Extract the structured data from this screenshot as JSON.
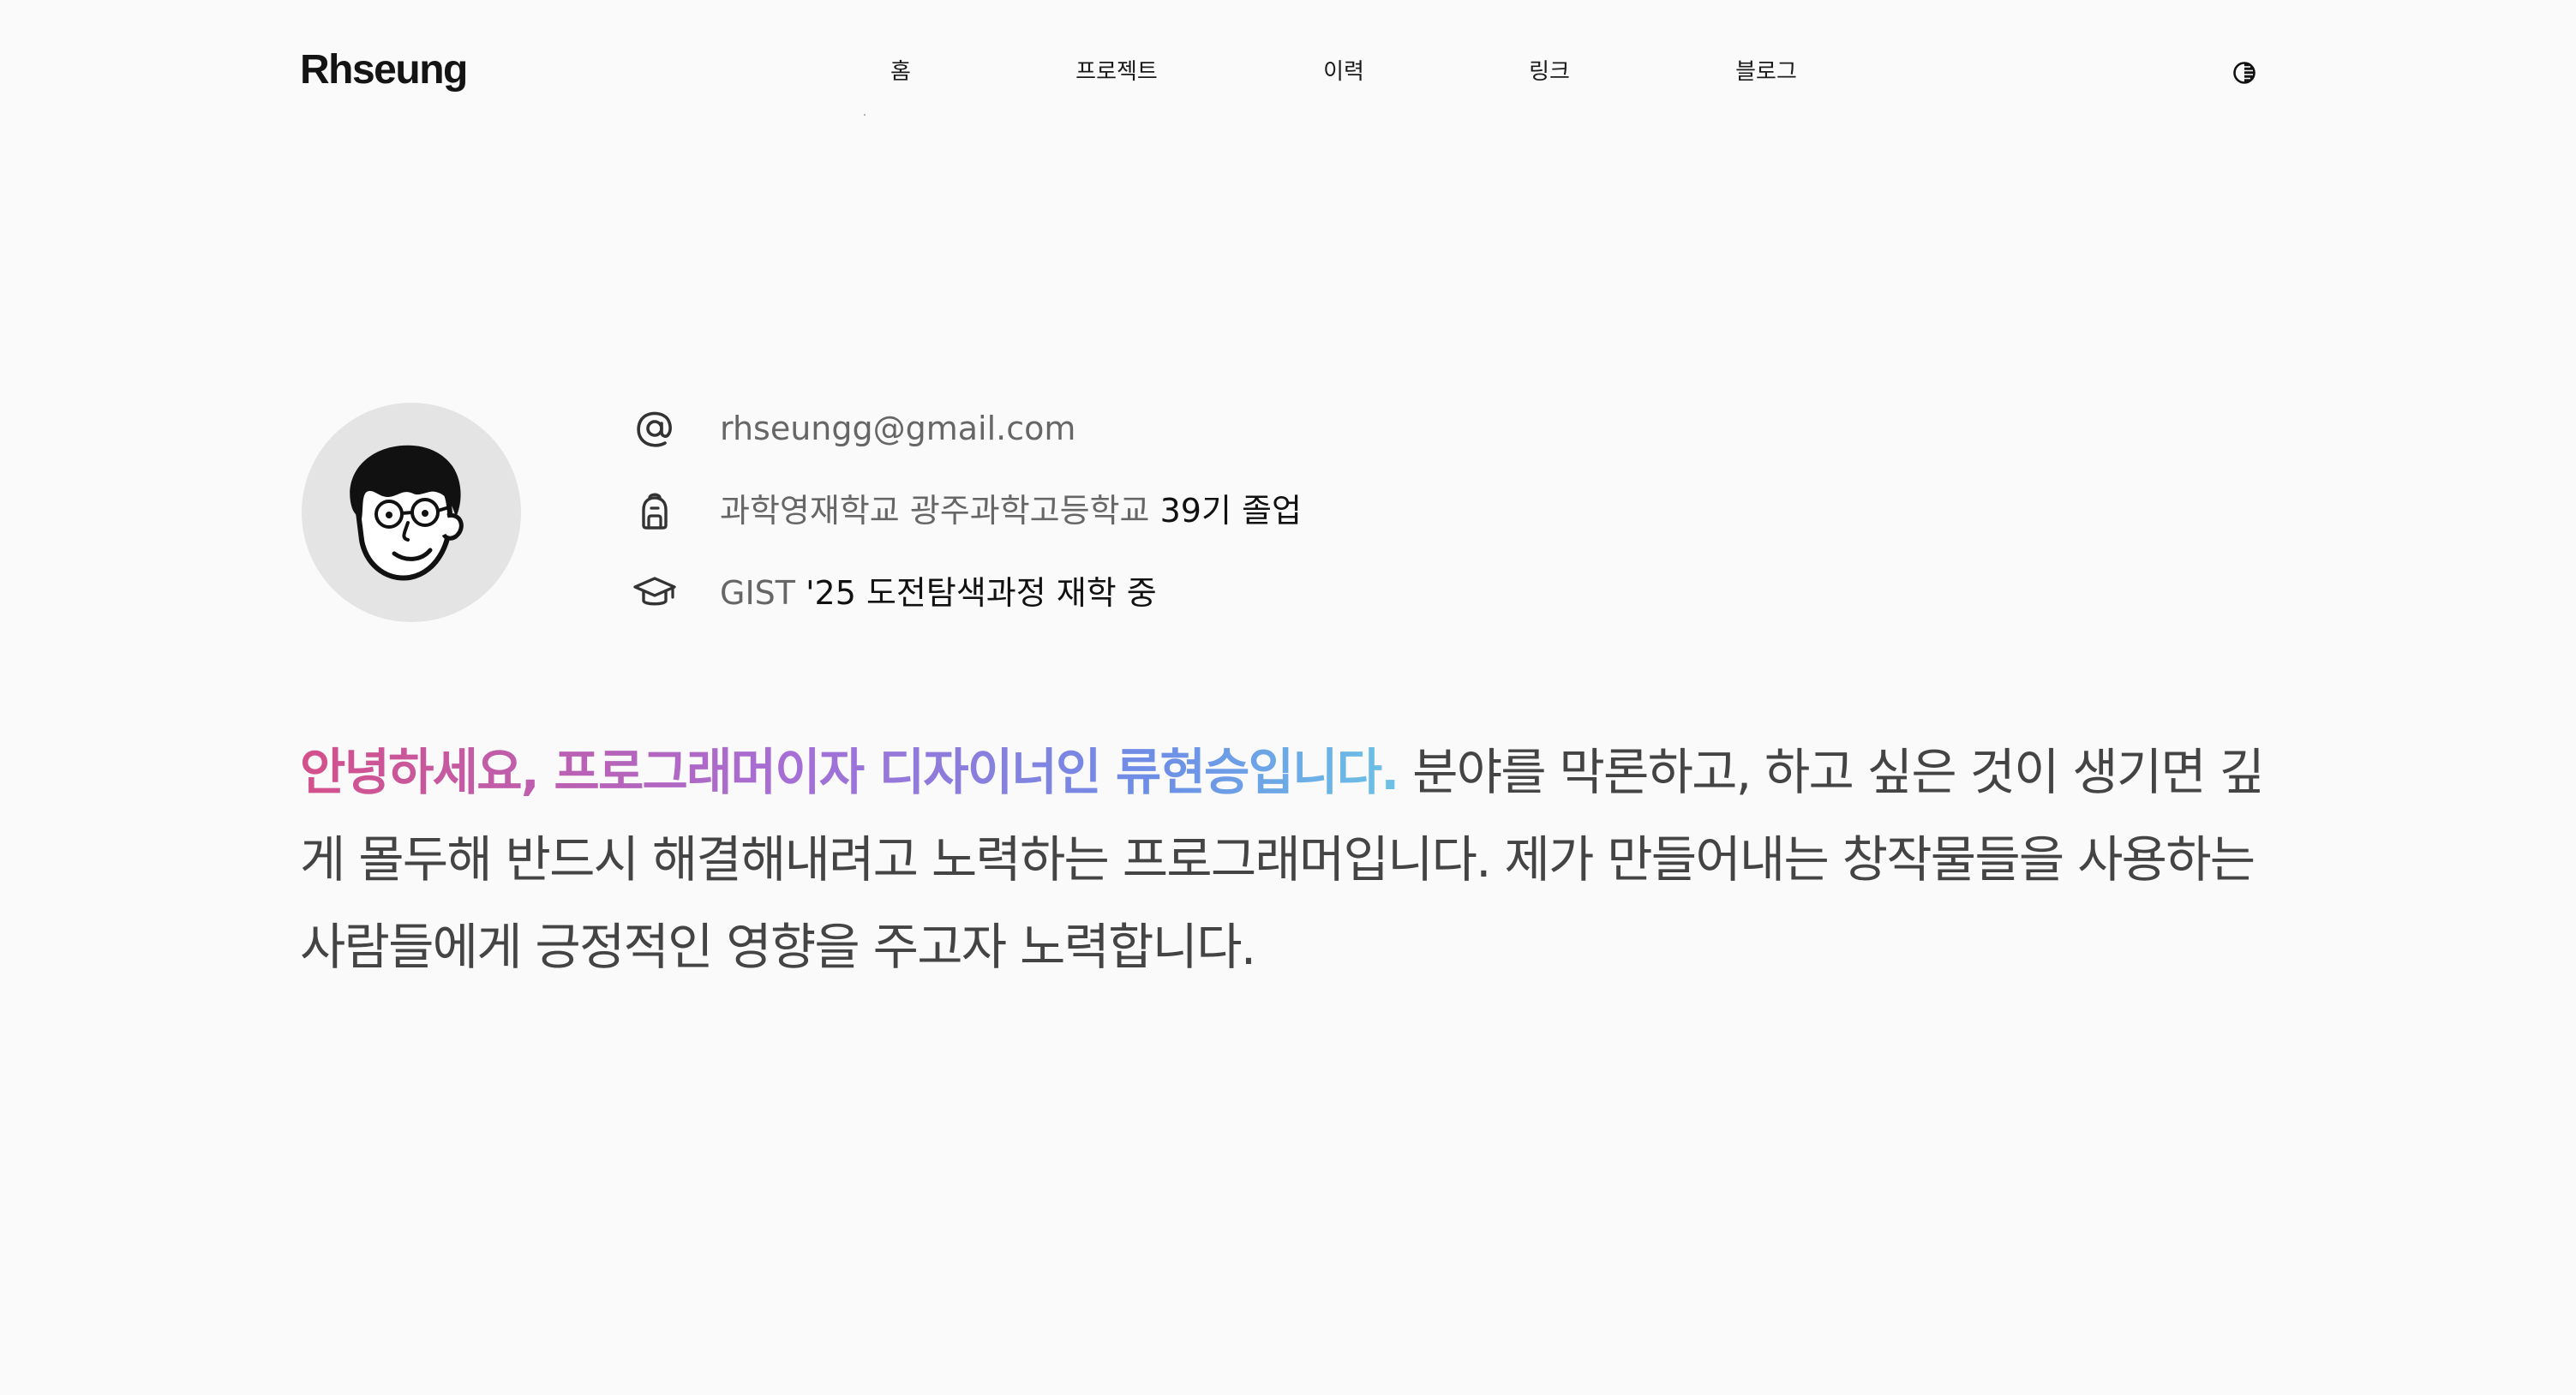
{
  "header": {
    "logo": "Rhseung",
    "nav": [
      {
        "label": "홈"
      },
      {
        "label": "프로젝트"
      },
      {
        "label": "이력"
      },
      {
        "label": "링크"
      },
      {
        "label": "블로그"
      }
    ],
    "theme_toggle_icon": "contrast-icon"
  },
  "profile": {
    "avatar_icon": "cartoon-face-avatar",
    "email": {
      "icon": "at-icon",
      "text": "rhseungg@gmail.com"
    },
    "school": {
      "icon": "backpack-icon",
      "text_muted": "과학영재학교 광주과학고등학교 ",
      "text_strong": "39기 졸업"
    },
    "university": {
      "icon": "graduation-cap-icon",
      "text_muted": "GIST ",
      "text_strong": "'25 도전탐색과정 재학 중"
    }
  },
  "intro": {
    "highlight": "안녕하세요, 프로그래머이자 디자이너인 류현승입니다.",
    "body": " 분야를 막론하고, 하고 싶은 것이 생기면 깊게 몰두해 반드시 해결해내려고 노력하는 프로그래머입니다. 제가 만들어내는 창작물들을 사용하는 사람들에게 긍정적인 영향을 주고자 노력합니다."
  },
  "colors": {
    "background": "#fafafa",
    "gradient_start": "#d4508a",
    "gradient_mid": "#a56fd6",
    "gradient_end": "#6cc2e6",
    "text_muted": "#666666"
  }
}
